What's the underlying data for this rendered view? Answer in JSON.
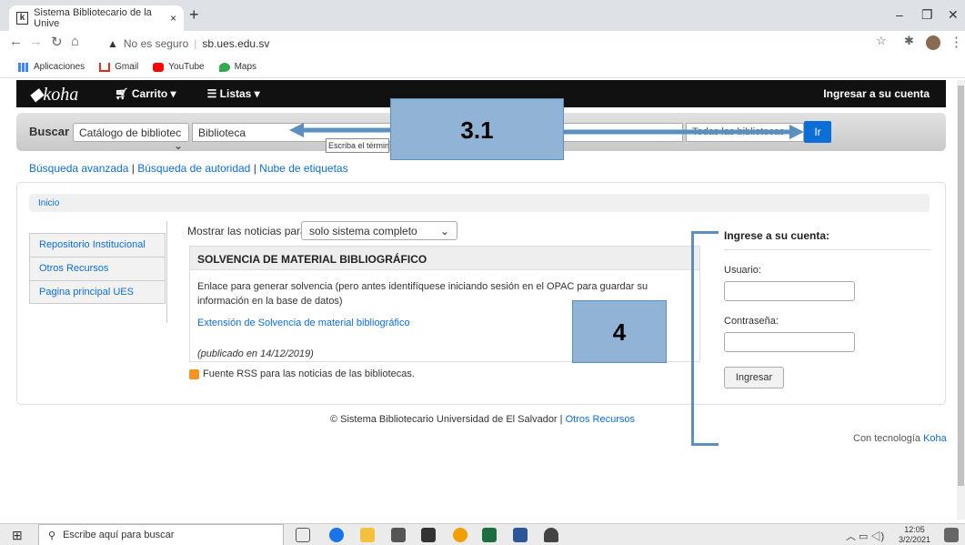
{
  "browser": {
    "tab_title": "Sistema Bibliotecario de la Unive",
    "tab_close": "×",
    "new_tab": "+",
    "url_warning": "No es seguro",
    "url": "sb.ues.edu.sv",
    "bookmarks": [
      "Aplicaciones",
      "Gmail",
      "YouTube",
      "Maps"
    ]
  },
  "koha_nav": {
    "logo": "koha",
    "cart": "Carrito",
    "lists": "Listas",
    "login": "Ingresar a su cuenta"
  },
  "search": {
    "label": "Buscar",
    "catalog_select": "Catálogo de bibliotec",
    "query": "Biblioteca",
    "tooltip": "Escriba el términ",
    "library_select": "Todas las bibliotecas",
    "go": "Ir"
  },
  "annotations": {
    "callout_1": "3.1",
    "callout_2": "4"
  },
  "links": {
    "advanced": "Búsqueda avanzada",
    "authority": "Búsqueda de autoridad",
    "tags": "Nube de etiquetas",
    "sep": "|"
  },
  "breadcrumb": "Inicio",
  "sidebar": {
    "items": [
      {
        "label": "Repositorio Institucional"
      },
      {
        "label": "Otros Recursos"
      },
      {
        "label": "Pagina principal UES"
      }
    ]
  },
  "news": {
    "show_label": "Mostrar las noticias para:",
    "show_value": "solo sistema completo",
    "title": "SOLVENCIA DE MATERIAL BIBLIOGRÁFICO",
    "body": "Enlace para generar solvencia (pero antes identifíquese iniciando sesión en el OPAC para guardar su información en la base de datos)",
    "link": "Extensión de Solvencia de material bibliográfico",
    "published": "(publicado en 14/12/2019)",
    "rss": "Fuente RSS para las noticias de las bibliotecas."
  },
  "login": {
    "heading": "Ingrese a su cuenta:",
    "user_label": "Usuario:",
    "pass_label": "Contraseña:",
    "button": "Ingresar"
  },
  "footer": {
    "copyright": "© Sistema Bibliotecario Universidad de El Salvador |",
    "link": "Otros Recursos",
    "powered": "Con tecnología",
    "koha": "Koha"
  },
  "taskbar": {
    "search_placeholder": "Escribe aquí para buscar",
    "time": "12:05",
    "date": "3/2/2021"
  },
  "colors": {
    "accent": "#0d6ed5",
    "callout": "#90b3d6",
    "bar": "#111111"
  }
}
